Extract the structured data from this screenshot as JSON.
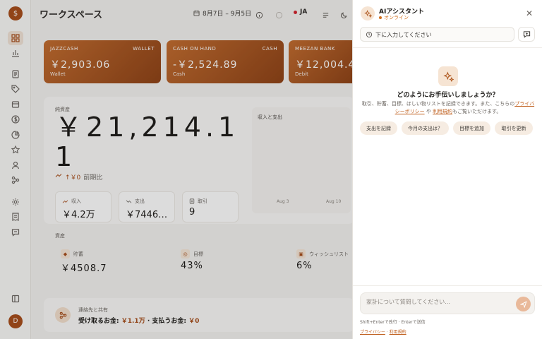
{
  "app": {
    "logo": "$",
    "user_initial": "D"
  },
  "sidebar": {
    "items": [
      {
        "icon": "grid-icon",
        "active": true
      },
      {
        "icon": "bar-chart-icon"
      },
      {
        "icon": "document-icon"
      },
      {
        "icon": "tag-icon"
      },
      {
        "icon": "database-icon"
      },
      {
        "icon": "dollar-icon"
      },
      {
        "icon": "pie-chart-icon"
      },
      {
        "icon": "star-icon"
      },
      {
        "icon": "user-icon"
      },
      {
        "icon": "share-icon"
      },
      {
        "icon": "settings-icon"
      },
      {
        "icon": "receipt-icon"
      },
      {
        "icon": "chat-icon"
      },
      {
        "icon": "panel-icon"
      }
    ]
  },
  "header": {
    "title": "ワークスペース",
    "date_range": "8月7日 – 9月5日",
    "language": "JA"
  },
  "wallets": [
    {
      "name": "JAZZCASH",
      "type": "WALLET",
      "balance": "￥2,903.06",
      "subtitle": "Wallet"
    },
    {
      "name": "CASH ON HAND",
      "type": "CASH",
      "balance": "-￥2,524.89",
      "subtitle": "Cash"
    },
    {
      "name": "MEEZAN BANK",
      "type": "",
      "balance": "￥12,004.4",
      "subtitle": "Debit"
    }
  ],
  "balance": {
    "label": "純資産",
    "value": "￥21,214.11",
    "change_amount": "↑￥0",
    "change_label": "前期比"
  },
  "mini_chart": {
    "title": "収入と支出",
    "x_labels": [
      "Aug 3",
      "Aug 10"
    ]
  },
  "stats": [
    {
      "label": "収入",
      "value": "￥4.2万"
    },
    {
      "label": "支出",
      "value": "￥7446…"
    },
    {
      "label": "取引",
      "value": "9"
    }
  ],
  "assets": {
    "label": "資産",
    "items": [
      {
        "label": "貯蓄",
        "value": "￥4508.7"
      },
      {
        "label": "目標",
        "value": "43%"
      },
      {
        "label": "ウィッシュリスト",
        "value": "6%"
      }
    ]
  },
  "share": {
    "title": "連絡先と共有",
    "receive_label": "受け取るお金:",
    "receive_amount": "￥1.1万",
    "pay_label": "· 支払うお金:",
    "pay_amount": "￥0"
  },
  "assistant": {
    "title": "AIアシスタント",
    "status": "オンライン",
    "history_text": "下に入力してください",
    "welcome_title": "どのようにお手伝いしましょうか？",
    "welcome_body_1": "取引、貯蓄、目標、ほしい物リストを記録できます。また、こちらの",
    "privacy_link": "プライバシーポリシー",
    "welcome_body_2": " や ",
    "terms_link": "利用規約",
    "welcome_body_3": "もご覧いただけます。",
    "chips": [
      "支出を記録",
      "今月の支出は？",
      "目標を追加",
      "取引を更新"
    ],
    "input_placeholder": "家計について質問してください...",
    "hint": "Shift+Enterで改行 · Enterで送信",
    "footer_privacy": "プライバシー",
    "footer_sep": " · ",
    "footer_terms": "利用規約"
  }
}
